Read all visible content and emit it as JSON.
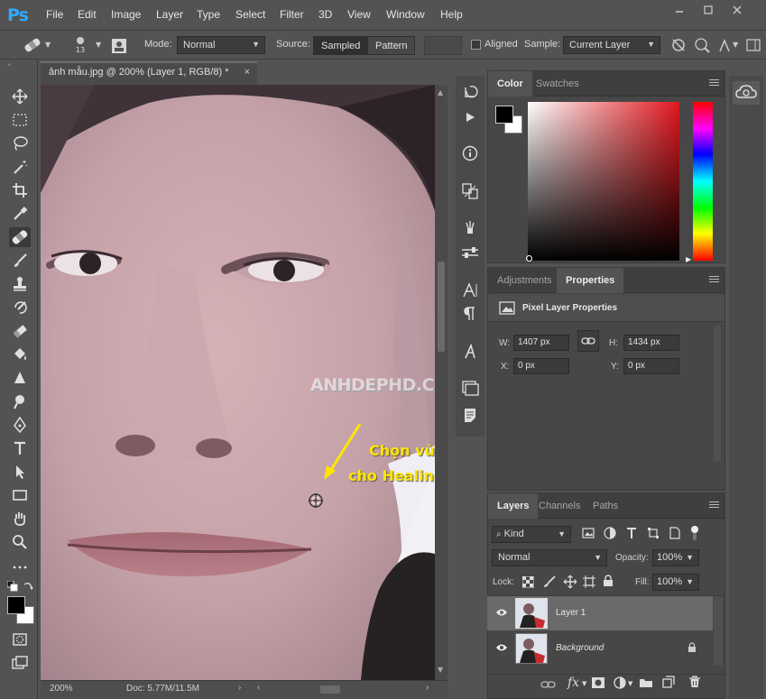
{
  "app": {
    "logo": "Ps"
  },
  "menu": [
    "File",
    "Edit",
    "Image",
    "Layer",
    "Type",
    "Select",
    "Filter",
    "3D",
    "View",
    "Window",
    "Help"
  ],
  "options": {
    "brush_size": "13",
    "mode_label": "Mode:",
    "mode_value": "Normal",
    "source_label": "Source:",
    "source_sampled": "Sampled",
    "source_pattern": "Pattern",
    "aligned_label": "Aligned",
    "sample_label": "Sample:",
    "sample_value": "Current Layer"
  },
  "document": {
    "tab_title": "ảnh mẫu.jpg @ 200% (Layer 1, RGB/8) *",
    "close": "×",
    "annotation_line1": "Chọn vùng da mẫu",
    "annotation_line2": "cho Healing Brush Tool",
    "watermark": "ANHDEPHD.COM"
  },
  "status": {
    "zoom": "200%",
    "doc": "Doc: 5.77M/11.5M"
  },
  "color_panel": {
    "tabs": [
      "Color",
      "Swatches"
    ],
    "fg": "#000000",
    "bg": "#ffffff",
    "hue_color": "#e2171e"
  },
  "properties_panel": {
    "tabs": [
      "Adjustments",
      "Properties"
    ],
    "title": "Pixel Layer Properties",
    "w_label": "W:",
    "w_value": "1407 px",
    "h_label": "H:",
    "h_value": "1434 px",
    "x_label": "X:",
    "x_value": "0 px",
    "y_label": "Y:",
    "y_value": "0 px"
  },
  "layers_panel": {
    "tabs": [
      "Layers",
      "Channels",
      "Paths"
    ],
    "filter_kind": "Kind",
    "blend_mode": "Normal",
    "opacity_label": "Opacity:",
    "opacity_value": "100%",
    "lock_label": "Lock:",
    "fill_label": "Fill:",
    "fill_value": "100%",
    "layers": [
      {
        "name": "Layer 1",
        "selected": true
      },
      {
        "name": "Background",
        "selected": false,
        "locked": true
      }
    ],
    "fx_label": "fx"
  },
  "colors": {
    "accent_ps": "#31a8ff",
    "annotation": "#ffe600"
  }
}
